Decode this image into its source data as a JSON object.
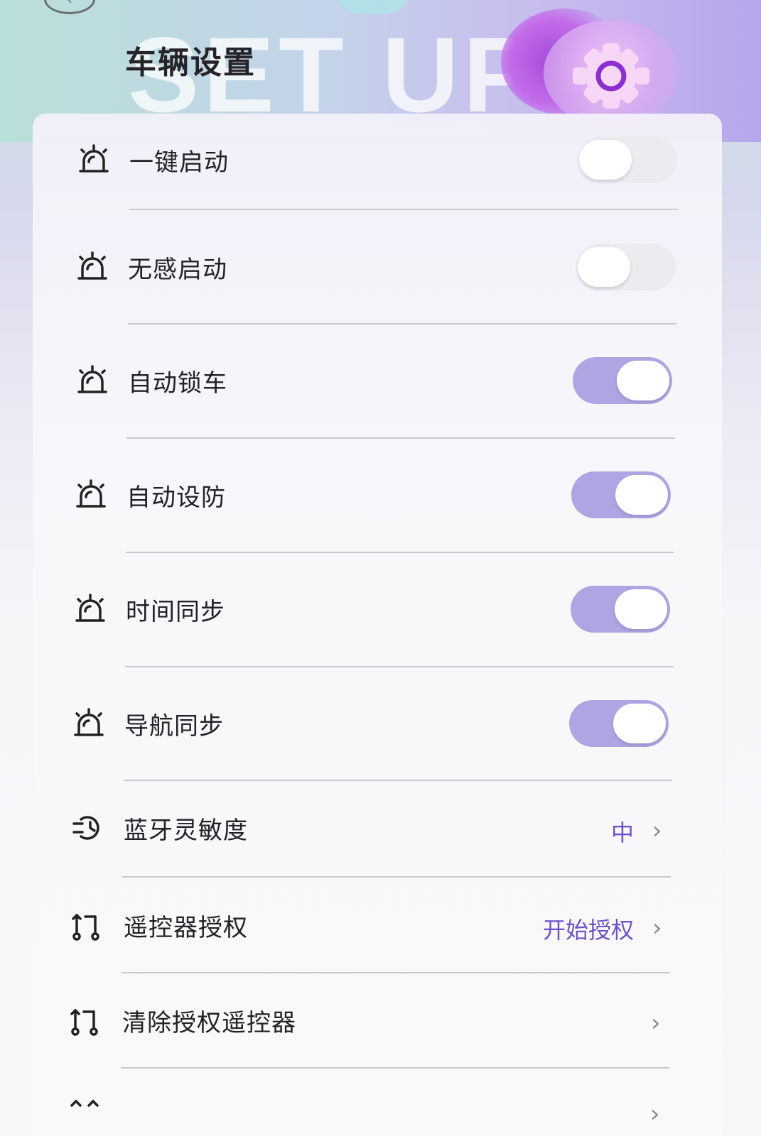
{
  "header": {
    "title": "车辆设置",
    "watermark": "SET UP",
    "back_icon": "chevron-left-icon",
    "settings_icon": "gear-icon"
  },
  "colors": {
    "toggle_on": "#aea6e2",
    "toggle_off": "#ecebf0",
    "value_accent": "#6a54c8"
  },
  "settings": {
    "items": [
      {
        "label": "一键启动",
        "icon": "alarm-light-icon",
        "type": "toggle",
        "on": false
      },
      {
        "label": "无感启动",
        "icon": "alarm-light-icon",
        "type": "toggle",
        "on": false
      },
      {
        "label": "自动锁车",
        "icon": "alarm-light-icon",
        "type": "toggle",
        "on": true
      },
      {
        "label": "自动设防",
        "icon": "alarm-light-icon",
        "type": "toggle",
        "on": true
      },
      {
        "label": "时间同步",
        "icon": "alarm-light-icon",
        "type": "toggle",
        "on": true
      },
      {
        "label": "导航同步",
        "icon": "alarm-light-icon",
        "type": "toggle",
        "on": true
      },
      {
        "label": "蓝牙灵敏度",
        "icon": "bluetooth-sensitivity-icon",
        "type": "select",
        "value": "中"
      },
      {
        "label": "遥控器授权",
        "icon": "remote-auth-icon",
        "type": "link",
        "value": "开始授权"
      },
      {
        "label": "清除授权遥控器",
        "icon": "remote-auth-icon",
        "type": "link",
        "value": ""
      }
    ]
  }
}
